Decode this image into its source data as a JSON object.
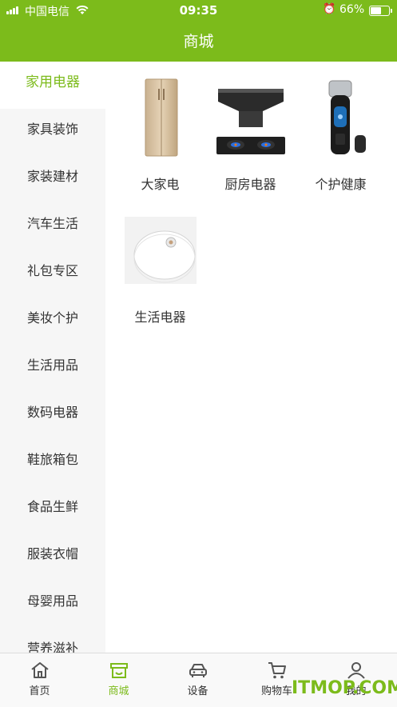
{
  "status_bar": {
    "carrier": "中国电信",
    "time": "09:35",
    "battery_percent": "66%",
    "battery_level": 0.66,
    "signal_icon": "signal-bars-icon",
    "wifi_icon": "wifi-icon",
    "alarm_icon": "alarm-clock-icon"
  },
  "header": {
    "title": "商城"
  },
  "sidebar": {
    "items": [
      {
        "label": "家用电器"
      },
      {
        "label": "家具装饰"
      },
      {
        "label": "家装建材"
      },
      {
        "label": "汽车生活"
      },
      {
        "label": "礼包专区"
      },
      {
        "label": "美妆个护"
      },
      {
        "label": "生活用品"
      },
      {
        "label": "数码电器"
      },
      {
        "label": "鞋旅箱包"
      },
      {
        "label": "食品生鲜"
      },
      {
        "label": "服装衣帽"
      },
      {
        "label": "母婴用品"
      },
      {
        "label": "营养滋补"
      }
    ],
    "active": "家用电器"
  },
  "categories": [
    {
      "label": "大家电",
      "image": "refrigerator-image"
    },
    {
      "label": "厨房电器",
      "image": "range-hood-stove-image"
    },
    {
      "label": "个护健康",
      "image": "electric-shaver-image"
    },
    {
      "label": "生活电器",
      "image": "robot-vacuum-image"
    }
  ],
  "bottom_nav": {
    "items": [
      {
        "label": "首页",
        "icon": "home-icon"
      },
      {
        "label": "商城",
        "icon": "store-icon"
      },
      {
        "label": "设备",
        "icon": "car-icon"
      },
      {
        "label": "购物车",
        "icon": "cart-icon"
      },
      {
        "label": "我的",
        "icon": "user-icon"
      }
    ],
    "active": "商城"
  },
  "watermark": "ITMOP.COM",
  "colors": {
    "accent": "#7cbb1b",
    "sidebar_bg": "#f6f6f6",
    "text": "#333333"
  }
}
